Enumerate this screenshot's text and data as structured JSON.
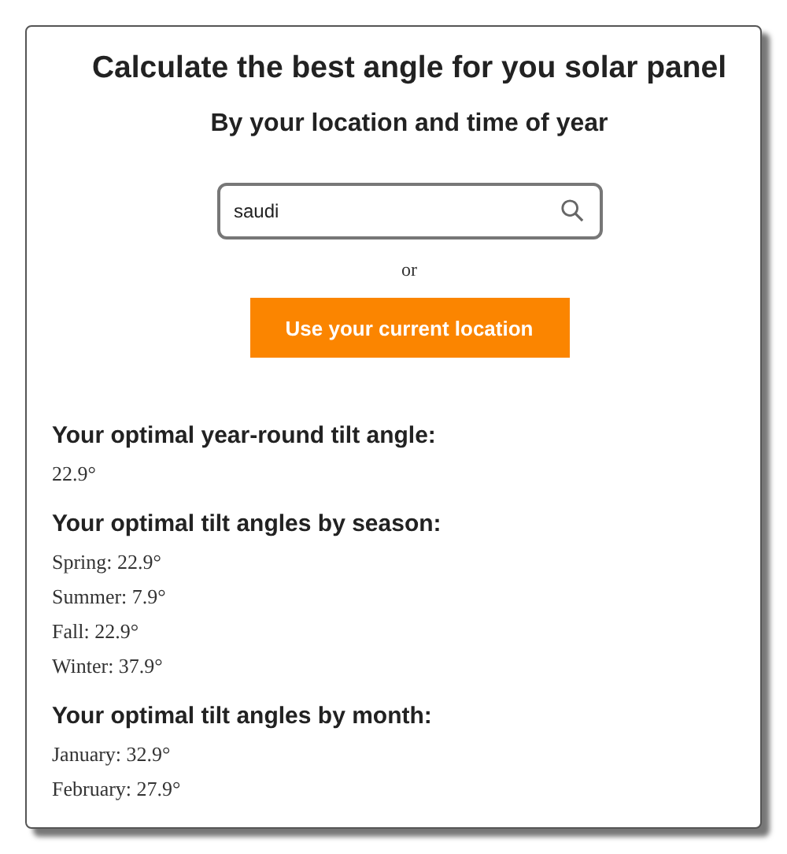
{
  "title": "Calculate the best angle for you solar panel",
  "subtitle": "By your location and time of year",
  "search": {
    "value": "saudi"
  },
  "separator": "or",
  "location_button": "Use your current location",
  "sections": [
    {
      "heading": "Your optimal year-round tilt angle:",
      "items": [
        "22.9°"
      ]
    },
    {
      "heading": "Your optimal tilt angles by season:",
      "items": [
        "Spring: 22.9°",
        "Summer: 7.9°",
        "Fall: 22.9°",
        "Winter: 37.9°"
      ]
    },
    {
      "heading": "Your optimal tilt angles by month:",
      "items": [
        "January: 32.9°",
        "February: 27.9°"
      ]
    }
  ]
}
